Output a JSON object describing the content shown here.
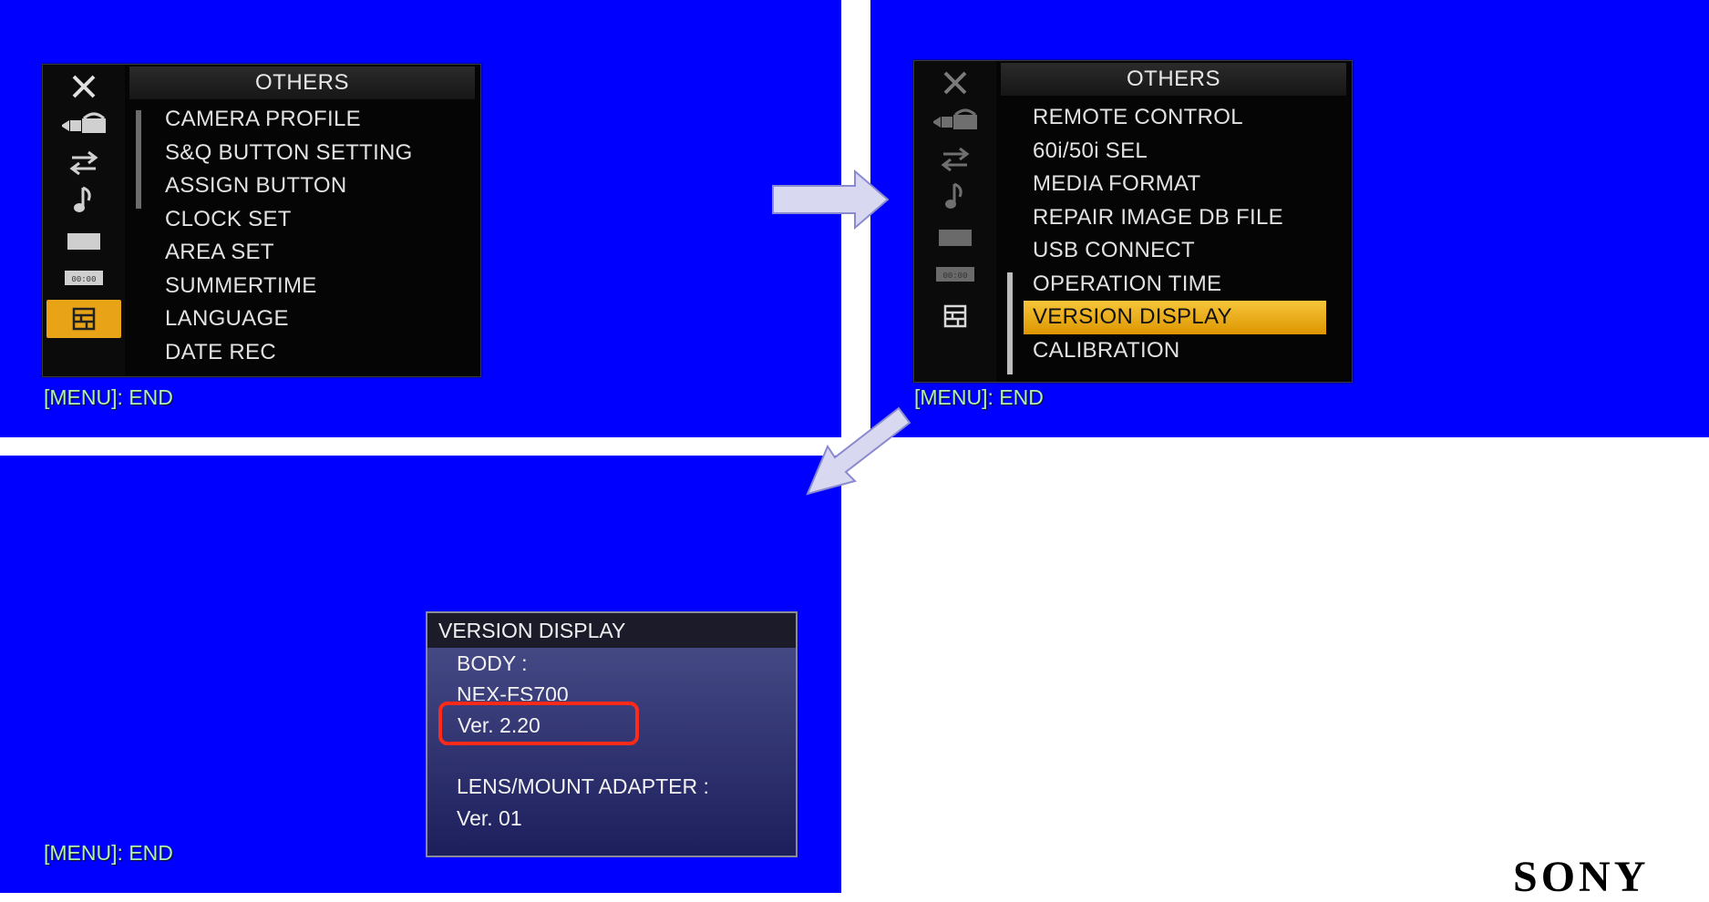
{
  "menu_others_1": {
    "title": "OTHERS",
    "items": [
      "CAMERA PROFILE",
      "S&Q BUTTON SETTING",
      "ASSIGN BUTTON",
      "CLOCK SET",
      "AREA SET",
      "SUMMERTIME",
      "LANGUAGE",
      "DATE REC"
    ],
    "footer": "[MENU]: END"
  },
  "menu_others_2": {
    "title": "OTHERS",
    "items": [
      "REMOTE CONTROL",
      "60i/50i SEL",
      "MEDIA FORMAT",
      "REPAIR IMAGE DB FILE",
      "USB CONNECT",
      "OPERATION TIME",
      "VERSION DISPLAY",
      "CALIBRATION"
    ],
    "highlighted": "VERSION DISPLAY",
    "footer": "[MENU]: END"
  },
  "version_display": {
    "title": "VERSION DISPLAY",
    "body_label": "BODY :",
    "model": "NEX-FS700",
    "body_version": "Ver. 2.20",
    "lens_label": "LENS/MOUNT ADAPTER :",
    "lens_version": "Ver. 01",
    "footer": "[MENU]: END"
  },
  "icons": [
    "close-icon",
    "camera-icon",
    "swap-icon",
    "music-note-icon",
    "display-icon",
    "timecode-icon",
    "others-icon"
  ],
  "brand": "SONY",
  "colors": {
    "panel_bg": "#0000ff",
    "highlight": "#e8a317",
    "footer_text": "#aef0b0",
    "callout": "#ff2a1a",
    "arrow_fill": "#d8d8f0"
  }
}
